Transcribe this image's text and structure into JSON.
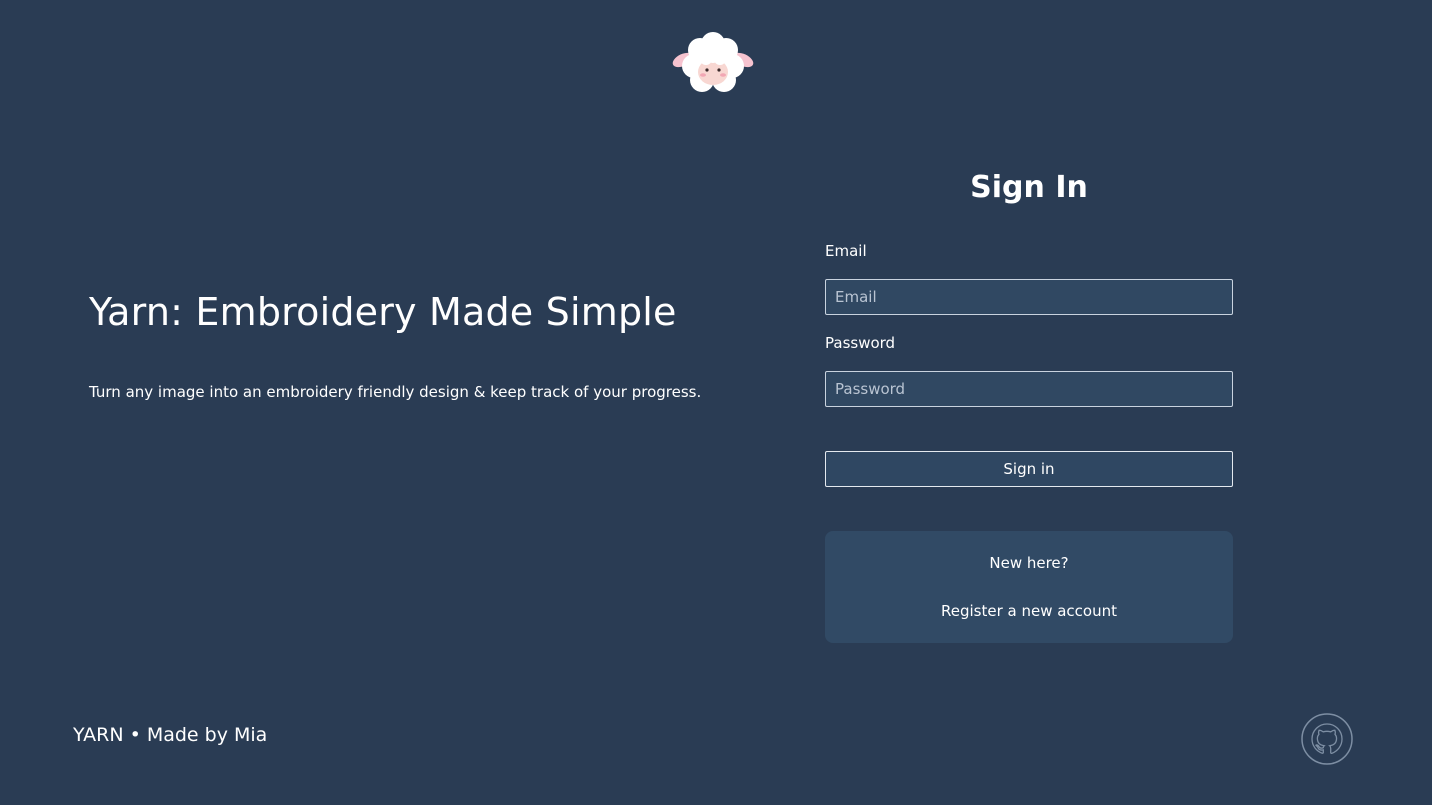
{
  "logo": {
    "icon": "sheep-icon"
  },
  "hero": {
    "title": "Yarn: Embroidery Made Simple",
    "subtitle": "Turn any image into an embroidery friendly design & keep track of your progress."
  },
  "signin": {
    "title": "Sign In",
    "email_label": "Email",
    "email_placeholder": "Email",
    "email_value": "",
    "password_label": "Password",
    "password_placeholder": "Password",
    "password_value": "",
    "button_label": "Sign in"
  },
  "register": {
    "prompt": "New here?",
    "link_label": "Register a new account"
  },
  "footer": {
    "text": "YARN • Made by Mia",
    "github_icon": "github-icon"
  },
  "colors": {
    "background": "#2a3c54",
    "input_bg": "#304862",
    "panel_bg": "#314a65",
    "text": "#ffffff"
  }
}
